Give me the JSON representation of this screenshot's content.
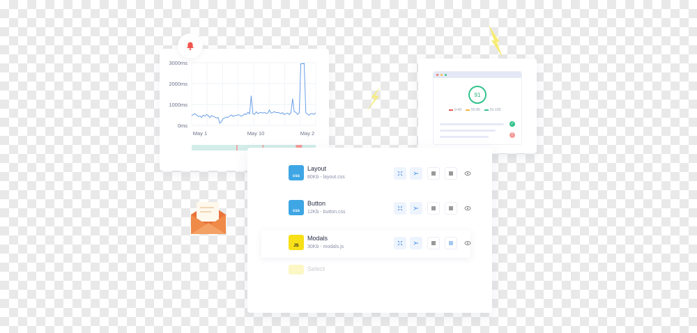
{
  "chart_card": {
    "y_ticks": [
      "3000ms",
      "2000ms",
      "1000ms",
      "0ms"
    ],
    "x_ticks": [
      "May 1",
      "May 10",
      "May 2"
    ]
  },
  "chart_data": {
    "type": "line",
    "x_ticks": [
      "May 1",
      "May 10",
      "May 2"
    ],
    "y_ticks": [
      "0ms",
      "1000ms",
      "2000ms",
      "3000ms"
    ],
    "ylim": [
      0,
      3000
    ],
    "grid": true,
    "series": [
      {
        "values": [
          470,
          520,
          560,
          500,
          430,
          450,
          380,
          490,
          440,
          520,
          470,
          380,
          470,
          430,
          400,
          350,
          380,
          100,
          180,
          330,
          360,
          400,
          380,
          450,
          500,
          430,
          470,
          470,
          510,
          490,
          440,
          480,
          550,
          520,
          630,
          550,
          1420,
          560,
          530,
          650,
          560,
          610,
          620,
          590,
          620,
          570,
          590,
          740,
          590,
          610,
          660,
          610,
          620,
          600,
          560,
          610,
          520,
          560,
          590,
          520,
          600,
          1280,
          650,
          630,
          520,
          600,
          2950,
          2950,
          2970,
          600,
          550,
          480,
          570,
          550,
          530,
          600
        ]
      }
    ],
    "timeline_segments": [
      {
        "fraction": 0.36,
        "color": "#d3ede9"
      },
      {
        "fraction": 0.01,
        "color": "#f29b97"
      },
      {
        "fraction": 0.2,
        "color": "#d3ede9"
      },
      {
        "fraction": 0.01,
        "color": "#f29b97"
      },
      {
        "fraction": 0.26,
        "color": "#d3ede9"
      },
      {
        "fraction": 0.05,
        "color": "#f29b97"
      },
      {
        "fraction": 0.11,
        "color": "#d3ede9"
      }
    ]
  },
  "score_card": {
    "score": "91",
    "legend": [
      {
        "label": "0-49",
        "color": "#e45a52"
      },
      {
        "label": "50-89",
        "color": "#f2b83b"
      },
      {
        "label": "91-100",
        "color": "#33c28d"
      }
    ],
    "window_dots": [
      "#f0756c",
      "#f3c04a",
      "#3fc58d"
    ]
  },
  "files": [
    {
      "name": "Layout",
      "meta": "80Kb - layout.css",
      "badge": "css",
      "badge_bg": "#3ea6e4",
      "badge_fg": "#ffffff"
    },
    {
      "name": "Button",
      "meta": "12Kb - button.css",
      "badge": "css",
      "badge_bg": "#3ea6e4",
      "badge_fg": "#ffffff"
    },
    {
      "name": "Modals",
      "meta": "30Kb - modals.js",
      "badge": "JS",
      "badge_bg": "#f7e017",
      "badge_fg": "#222222"
    }
  ],
  "faded_item": "Select",
  "colors": {
    "accent": "#4a8fe7",
    "line": "#6a9ee6",
    "alert": "#f0554e",
    "bolt": "#f7ec74"
  }
}
